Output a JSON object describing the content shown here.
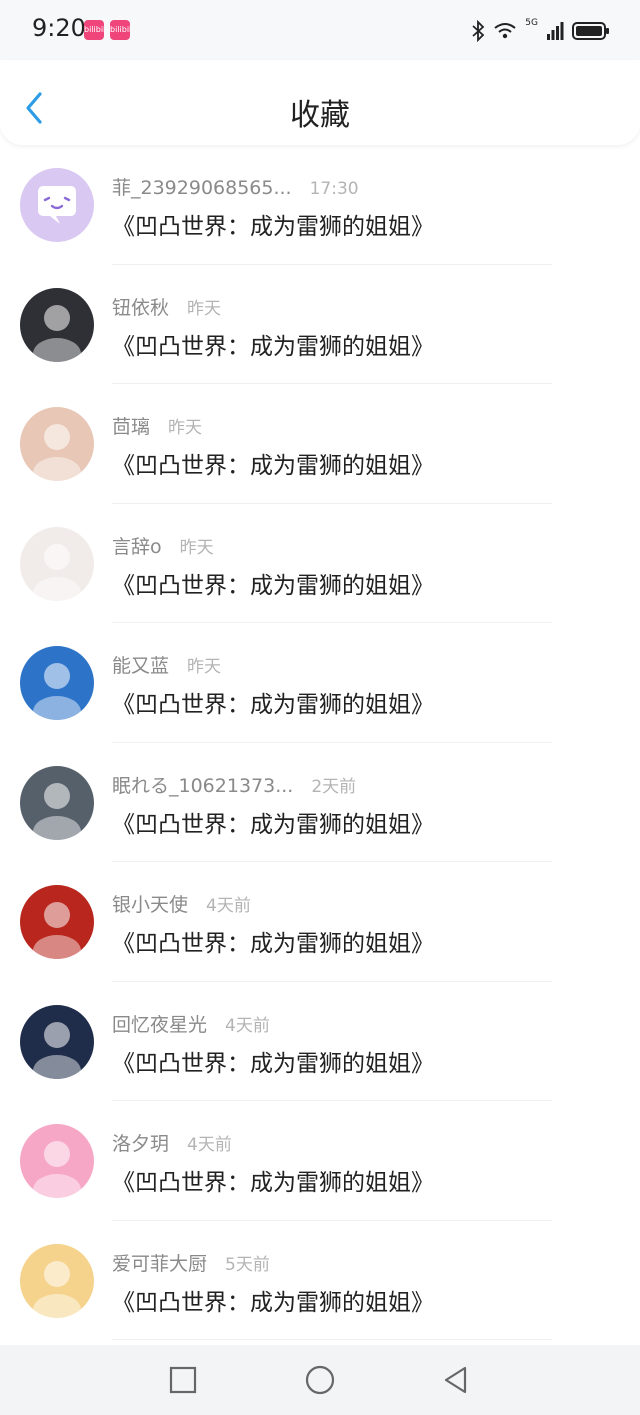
{
  "status_bar": {
    "time": "9:20",
    "badges": [
      "bilibili",
      "bilibili"
    ],
    "network": "5G"
  },
  "header": {
    "title": "收藏"
  },
  "items": [
    {
      "name": "菲_23929068565...",
      "time": "17:30",
      "title": "《凹凸世界：成为雷狮的姐姐》",
      "avatar_color": "#d9c8f2"
    },
    {
      "name": "钮依秋",
      "time": "昨天",
      "title": "《凹凸世界：成为雷狮的姐姐》",
      "avatar_color": "#2f3036"
    },
    {
      "name": "茴璃",
      "time": "昨天",
      "title": "《凹凸世界：成为雷狮的姐姐》",
      "avatar_color": "#e8c7b6"
    },
    {
      "name": "言辞o",
      "time": "昨天",
      "title": "《凹凸世界：成为雷狮的姐姐》",
      "avatar_color": "#f1ece9"
    },
    {
      "name": "能又蓝",
      "time": "昨天",
      "title": "《凹凸世界：成为雷狮的姐姐》",
      "avatar_color": "#2d74c9"
    },
    {
      "name": "眠れる_10621373...",
      "time": "2天前",
      "title": "《凹凸世界：成为雷狮的姐姐》",
      "avatar_color": "#56606b"
    },
    {
      "name": "银小天使",
      "time": "4天前",
      "title": "《凹凸世界：成为雷狮的姐姐》",
      "avatar_color": "#b8261d"
    },
    {
      "name": "回忆夜星光",
      "time": "4天前",
      "title": "《凹凸世界：成为雷狮的姐姐》",
      "avatar_color": "#1f2d4a"
    },
    {
      "name": "洛夕玥",
      "time": "4天前",
      "title": "《凹凸世界：成为雷狮的姐姐》",
      "avatar_color": "#f6a7c6"
    },
    {
      "name": "爱可菲大厨",
      "time": "5天前",
      "title": "《凹凸世界：成为雷狮的姐姐》",
      "avatar_color": "#f5d38c"
    }
  ],
  "colors": {
    "accent": "#2c9ce6",
    "name_text": "#8a8a8a",
    "time_text": "#b4b4b4",
    "title_text": "#222222"
  },
  "icons": {
    "back": "back-arrow-icon",
    "nav_recent": "square-icon",
    "nav_home": "circle-icon",
    "nav_back": "triangle-back-icon"
  }
}
